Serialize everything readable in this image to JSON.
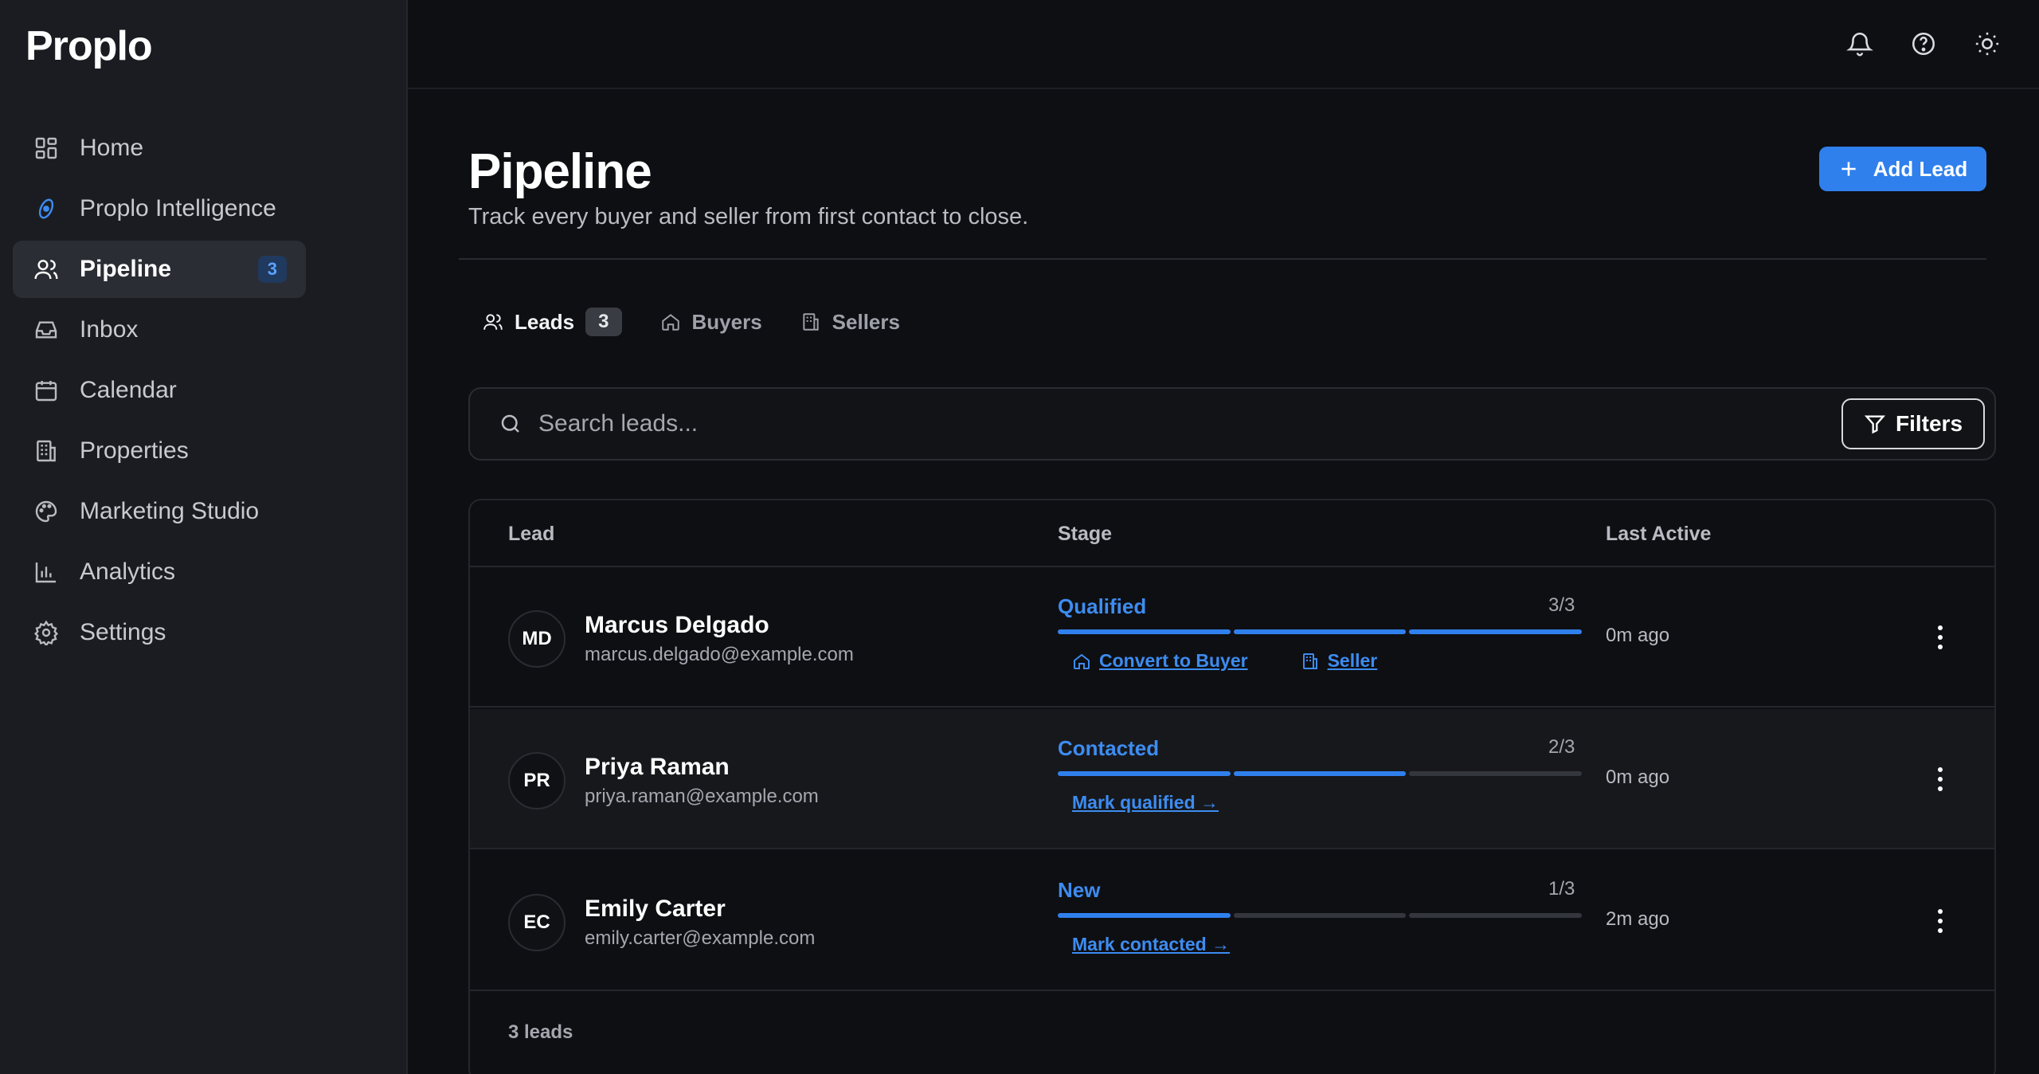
{
  "app": {
    "logo_text": "Proplo"
  },
  "sidebar": {
    "items": [
      {
        "label": "Home",
        "icon": "grid-icon"
      },
      {
        "label": "Proplo Intelligence",
        "icon": "intelligence-icon"
      },
      {
        "label": "Pipeline",
        "icon": "users-icon",
        "badge": "3",
        "active": true
      },
      {
        "label": "Inbox",
        "icon": "inbox-icon"
      },
      {
        "label": "Calendar",
        "icon": "calendar-icon"
      },
      {
        "label": "Properties",
        "icon": "building-icon"
      },
      {
        "label": "Marketing Studio",
        "icon": "palette-icon"
      },
      {
        "label": "Analytics",
        "icon": "bar-chart-icon"
      },
      {
        "label": "Settings",
        "icon": "gear-icon"
      }
    ]
  },
  "topbar": {
    "icons": [
      "bell-icon",
      "help-icon",
      "sun-icon"
    ]
  },
  "page": {
    "title": "Pipeline",
    "subtitle": "Track every buyer and seller from first contact to close.",
    "add_lead_label": "Add Lead"
  },
  "tabs": [
    {
      "label": "Leads",
      "count": "3",
      "active": true
    },
    {
      "label": "Buyers"
    },
    {
      "label": "Sellers"
    }
  ],
  "search": {
    "placeholder": "Search leads...",
    "value": ""
  },
  "filters_label": "Filters",
  "table": {
    "columns": [
      "Lead",
      "Stage",
      "Last Active"
    ],
    "rows": [
      {
        "initials": "MD",
        "name": "Marcus Delgado",
        "email": "marcus.delgado@example.com",
        "stage": "Qualified",
        "stage_count": "3/3",
        "progress_filled": 3,
        "progress_total": 3,
        "actions": [
          "Convert to Buyer",
          "Seller"
        ],
        "last_active": "0m ago"
      },
      {
        "initials": "PR",
        "name": "Priya Raman",
        "email": "priya.raman@example.com",
        "stage": "Contacted",
        "stage_count": "2/3",
        "progress_filled": 2,
        "progress_total": 3,
        "actions": [
          "Mark qualified →"
        ],
        "last_active": "0m ago"
      },
      {
        "initials": "EC",
        "name": "Emily Carter",
        "email": "emily.carter@example.com",
        "stage": "New",
        "stage_count": "1/3",
        "progress_filled": 1,
        "progress_total": 3,
        "actions": [
          "Mark contacted →"
        ],
        "last_active": "2m ago"
      }
    ],
    "footer": "3 leads"
  },
  "colors": {
    "accent": "#2f80ed",
    "background": "#0e0f13",
    "sidebar": "#1b1c21"
  }
}
